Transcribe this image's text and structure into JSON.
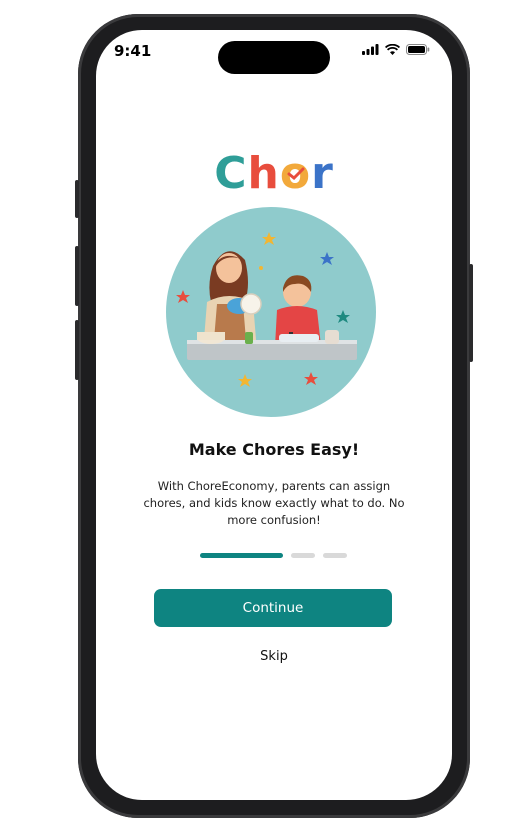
{
  "status_bar": {
    "time": "9:41"
  },
  "logo": {
    "letters": [
      "C",
      "h",
      "o",
      "r"
    ],
    "colors": [
      "#2f9e98",
      "#e84d3d",
      "#f2a93b",
      "#3b73c8"
    ]
  },
  "onboarding": {
    "title": "Make Chores Easy!",
    "description": "With ChoreEconomy, parents can assign chores, and kids know exactly what to do. No more confusion!",
    "progress": {
      "current_step": 1,
      "total_steps": 3
    }
  },
  "actions": {
    "continue_label": "Continue",
    "skip_label": "Skip"
  },
  "theme": {
    "accent": "#0e8481",
    "illustration_bg": "#8fcbcc"
  }
}
